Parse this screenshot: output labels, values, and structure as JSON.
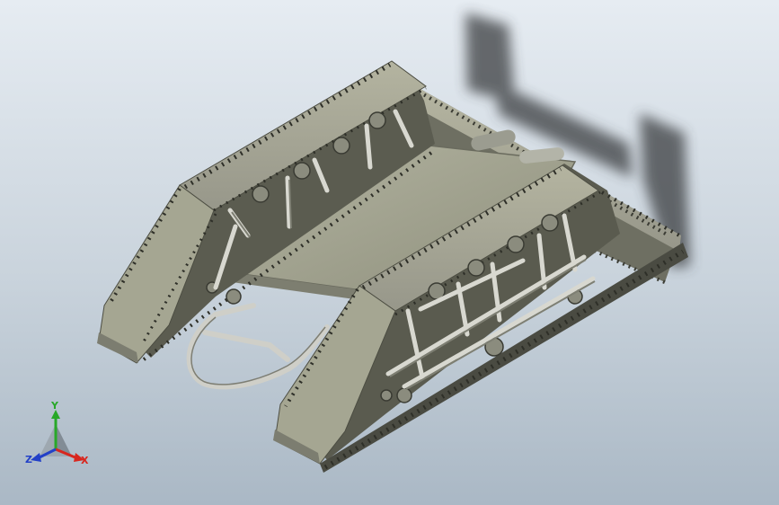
{
  "viewport": {
    "background_top": "#e6ecf2",
    "background_bottom": "#aab8c5"
  },
  "model": {
    "track_color": "#a2a28e",
    "track_dark": "#5f6052",
    "plate_color": "#a4a592",
    "frame_color": "#c8c8c0"
  },
  "triad": {
    "x_label": "X",
    "y_label": "Y",
    "z_label": "Z",
    "x_color": "#d8261e",
    "y_color": "#28a828",
    "z_color": "#2240c8"
  }
}
